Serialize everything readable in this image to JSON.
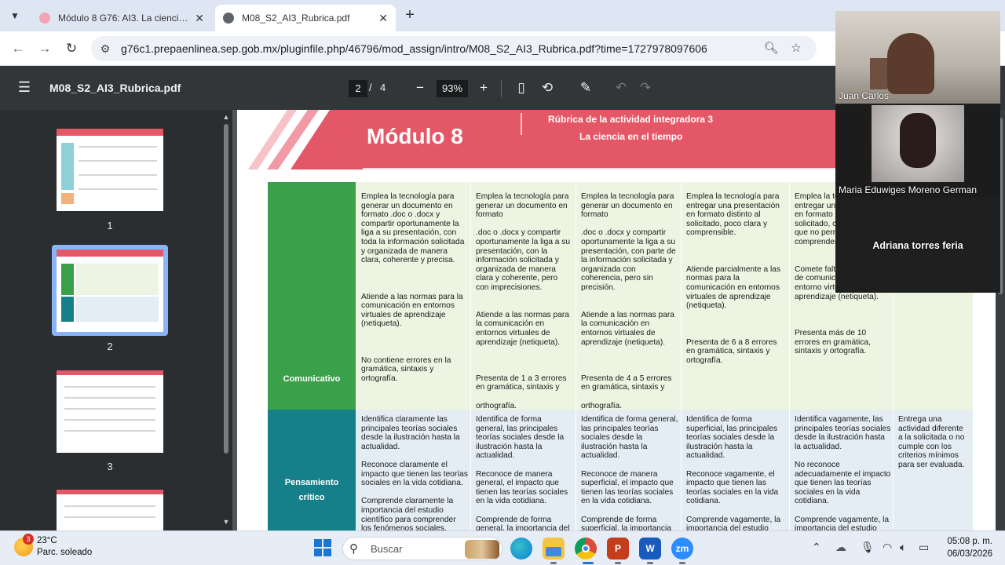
{
  "browser": {
    "tabs": [
      {
        "title": "Módulo 8 G76: AI3. La ciencia en el tiempo",
        "active": false
      },
      {
        "title": "M08_S2_AI3_Rubrica.pdf",
        "active": true
      }
    ],
    "url": "g76c1.prepaenlinea.sep.gob.mx/pluginfile.php/46796/mod_assign/intro/M08_S2_AI3_Rubrica.pdf?time=1727978097606"
  },
  "pdf": {
    "filename": "M08_S2_AI3_Rubrica.pdf",
    "current_page": "2",
    "page_sep": "/",
    "total_pages": "4",
    "zoom": "93%",
    "thumbnails": [
      "1",
      "2",
      "3"
    ],
    "selected_page": "2"
  },
  "document": {
    "module_title": "Módulo 8",
    "rubric_line1": "Rúbrica de la actividad integradora 3",
    "rubric_line2": "La ciencia en el tiempo",
    "rows": [
      {
        "label": "Comunicativo",
        "cells": [
          "Emplea la tecnología para generar un documento en formato .doc o .docx y compartir oportunamente la liga a su presentación, con toda la información solicitada y organizada de manera clara, coherente y precisa.\n\n\n\nAtiende a las normas para la comunicación en entornos virtuales de aprendizaje (netiqueta).\n\n\n\nNo contiene errores en la gramática, sintaxis y ortografía.",
          "Emplea la tecnología para generar un documento en formato\n\n.doc o .docx y compartir oportunamente la liga a su presentación, con la información solicitada y organizada de manera clara y coherente, pero con imprecisiones.\n\n\nAtiende a las normas para la comunicación en entornos virtuales de aprendizaje (netiqueta).\n\n\n\nPresenta de 1 a 3 errores en gramática, sintaxis y\n\northografía.",
          "Emplea la tecnología para generar un documento en formato\n\n.doc o .docx y compartir oportunamente la liga a su presentación, con parte de la información solicitada y organizada con coherencia, pero sin precisión.\n\n\nAtiende a las normas para la comunicación en entornos virtuales de aprendizaje (netiqueta).\n\n\n\nPresenta de 4 a 5 errores en gramática, sintaxis y\n\northografía.",
          "Emplea la tecnología para entregar una presentación en formato distinto al solicitado, poco clara y comprensible.\n\n\n\nAtiende parcialmente a las normas para la comunicación en entornos virtuales de aprendizaje (netiqueta).\n\n\n\nPresenta de 6 a 8 errores en gramática, sintaxis y ortografía.",
          "Emplea la tecnología para entregar una presentación en formato distinto al solicitado, con información que no permite comprender las ideas.\n\n\nComete faltas a las normas de comunicación en entorno virtuales de aprendizaje (netiqueta).\n\n\n\nPresenta más de 10 errores en gramática, sintaxis y ortografía.",
          ""
        ]
      },
      {
        "label": "Pensamiento crítico",
        "cells": [
          "Identifica claramente las principales teorías sociales desde la ilustración hasta la actualidad.\n\nReconoce claramente el impacto que tienen las teorías sociales en la vida cotidiana.\n\nComprende claramente la importancia del estudio científico para comprender los fenómenos sociales.",
          "Identifica de forma general, las principales teorías sociales desde la ilustración hasta la actualidad.\n\nReconoce de manera general, el impacto que tienen las teorías sociales en la vida cotidiana.\n\nComprende de forma general, la importancia del estudio científico.",
          "Identifica de forma general, las principales teorías sociales desde la ilustración hasta la actualidad.\n\nReconoce de manera superficial, el impacto que tienen las teorías sociales en la vida cotidiana.\n\nComprende de forma superficial, la importancia del estudio científico.",
          "Identifica de forma superficial, las principales teorías sociales desde la ilustración hasta la actualidad.\n\nReconoce vagamente, el impacto que tienen las teorías sociales en la vida cotidiana.\n\nComprende vagamente, la importancia del estudio científico para comprender los fenómenos sociales.",
          "Identifica vagamente, las principales teorías sociales desde la ilustración hasta la actualidad.\n\nNo reconoce adecuadamente el impacto que tienen las teorías sociales en la vida cotidiana.\n\nComprende vagamente, la importancia del estudio científico.",
          "Entrega una actividad diferente a la solicitada o no cumple con los criterios mínimos para ser evaluada."
        ]
      }
    ]
  },
  "video_call": {
    "participants": [
      "Juan Carlos",
      "Maria Eduwiges Moreno German",
      "Adriana torres feria"
    ]
  },
  "taskbar": {
    "temperature": "23°C",
    "weather": "Parc. soleado",
    "notification_count": "3",
    "search_placeholder": "Buscar",
    "time": "05:08 p. m.",
    "date": "06/03/2026",
    "zoom_app_label": "zm",
    "colors": {
      "chrome": "#dd4b39",
      "powerpoint": "#c43e1c",
      "word": "#185abd",
      "zoom": "#2d8cff",
      "edge": "#0c7fd6"
    }
  }
}
